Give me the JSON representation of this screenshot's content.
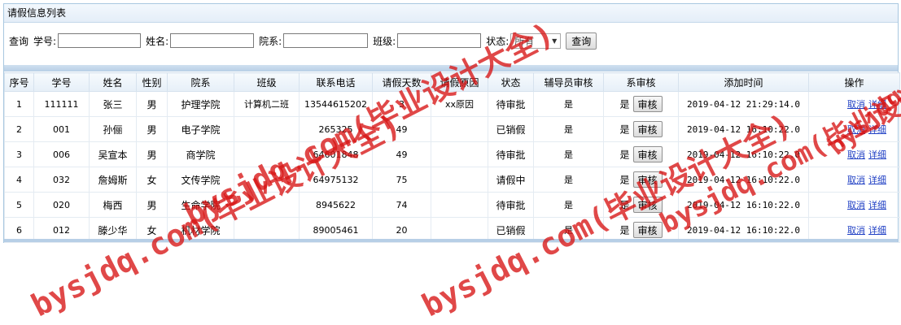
{
  "panel": {
    "title": "请假信息列表"
  },
  "query": {
    "label": "查询",
    "student_no_label": "学号:",
    "name_label": "姓名:",
    "dept_label": "院系:",
    "class_label": "班级:",
    "status_label": "状态:",
    "status_value": "所有",
    "button": "查询"
  },
  "table": {
    "columns": [
      "序号",
      "学号",
      "姓名",
      "性别",
      "院系",
      "班级",
      "联系电话",
      "请假天数",
      "请假原因",
      "状态",
      "辅导员审核",
      "系审核",
      "添加时间",
      "操作"
    ],
    "approve_button": "审核",
    "cancel_link": "取消",
    "detail_link": "详细",
    "rows": [
      {
        "no": "1",
        "sid": "111111",
        "name": "张三",
        "gender": "男",
        "dept": "护理学院",
        "cls": "计算机二班",
        "phone": "13544615202",
        "days": "3",
        "reason": "xx原因",
        "status": "待审批",
        "counselor": "是",
        "dept_review": "是",
        "time": "2019-04-12 21:29:14.0"
      },
      {
        "no": "2",
        "sid": "001",
        "name": "孙俪",
        "gender": "男",
        "dept": "电子学院",
        "cls": "",
        "phone": "265325",
        "days": "49",
        "reason": "",
        "status": "已销假",
        "counselor": "是",
        "dept_review": "是",
        "time": "2019-04-12 16:10:22.0"
      },
      {
        "no": "3",
        "sid": "006",
        "name": "吴宣本",
        "gender": "男",
        "dept": "商学院",
        "cls": "",
        "phone": "64601848",
        "days": "49",
        "reason": "",
        "status": "待审批",
        "counselor": "是",
        "dept_review": "是",
        "time": "2019-04-12 16:10:22.0"
      },
      {
        "no": "4",
        "sid": "032",
        "name": "詹姆斯",
        "gender": "女",
        "dept": "文传学院",
        "cls": "",
        "phone": "64975132",
        "days": "75",
        "reason": "",
        "status": "请假中",
        "counselor": "是",
        "dept_review": "是",
        "time": "2019-04-12 16:10:22.0"
      },
      {
        "no": "5",
        "sid": "020",
        "name": "梅西",
        "gender": "男",
        "dept": "生命学院",
        "cls": "",
        "phone": "8945622",
        "days": "74",
        "reason": "",
        "status": "待审批",
        "counselor": "是",
        "dept_review": "是",
        "time": "2019-04-12 16:10:22.0"
      },
      {
        "no": "6",
        "sid": "012",
        "name": "滕少华",
        "gender": "女",
        "dept": "机材学院",
        "cls": "",
        "phone": "89005461",
        "days": "20",
        "reason": "",
        "status": "已销假",
        "counselor": "是",
        "dept_review": "是",
        "time": "2019-04-12 16:10:22.0"
      }
    ]
  },
  "watermarks": {
    "w1": "bysjdq.com(毕业设计大全)",
    "w2": "bysjdq.com(毕业设计大全)",
    "w3": "bysjdq.com(毕业设计大全)",
    "w4": "bysjdq.com(毕业设计大全)",
    "w5": "bysjdq.com(毕业设计大全)"
  }
}
